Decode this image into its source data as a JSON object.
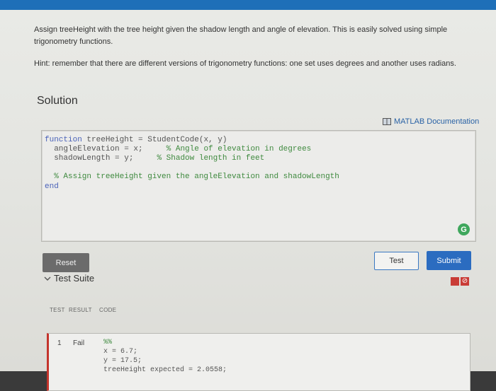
{
  "problem": {
    "description": "Assign treeHeight with the tree height given the shadow length and angle of elevation. This is easily solved using simple trigonometry functions.",
    "hint": "Hint: remember that there are different versions of trigonometry functions: one set uses degrees and another uses radians."
  },
  "solution": {
    "title": "Solution",
    "doc_link": "MATLAB Documentation",
    "code": {
      "line1_kw": "function",
      "line1_rest": " treeHeight = StudentCode(x, y)",
      "line2_code": "  angleElevation = x;     ",
      "line2_comment": "% Angle of elevation in degrees",
      "line3_code": "  shadowLength = y;     ",
      "line3_comment": "% Shadow length in feet",
      "line5_comment": "  % Assign treeHeight given the angleElevation and shadowLength",
      "line6_kw": "end"
    },
    "grammarly_label": "G"
  },
  "actions": {
    "reset_label": "Reset",
    "test_label": "Test",
    "submit_label": "Submit"
  },
  "test_suite": {
    "title": "Test Suite",
    "columns": [
      "TEST",
      "RESULT",
      "CODE"
    ],
    "rows": [
      {
        "test": "1",
        "result": "Fail",
        "code_lines": [
          "%%",
          "x = 6.7;",
          "y = 17.5;",
          "treeHeight expected = 2.0558;"
        ]
      }
    ]
  },
  "colors": {
    "accent": "#2b6cc0",
    "fail": "#c93c36",
    "comment": "#3f8a3f",
    "keyword": "#4a62b8"
  }
}
